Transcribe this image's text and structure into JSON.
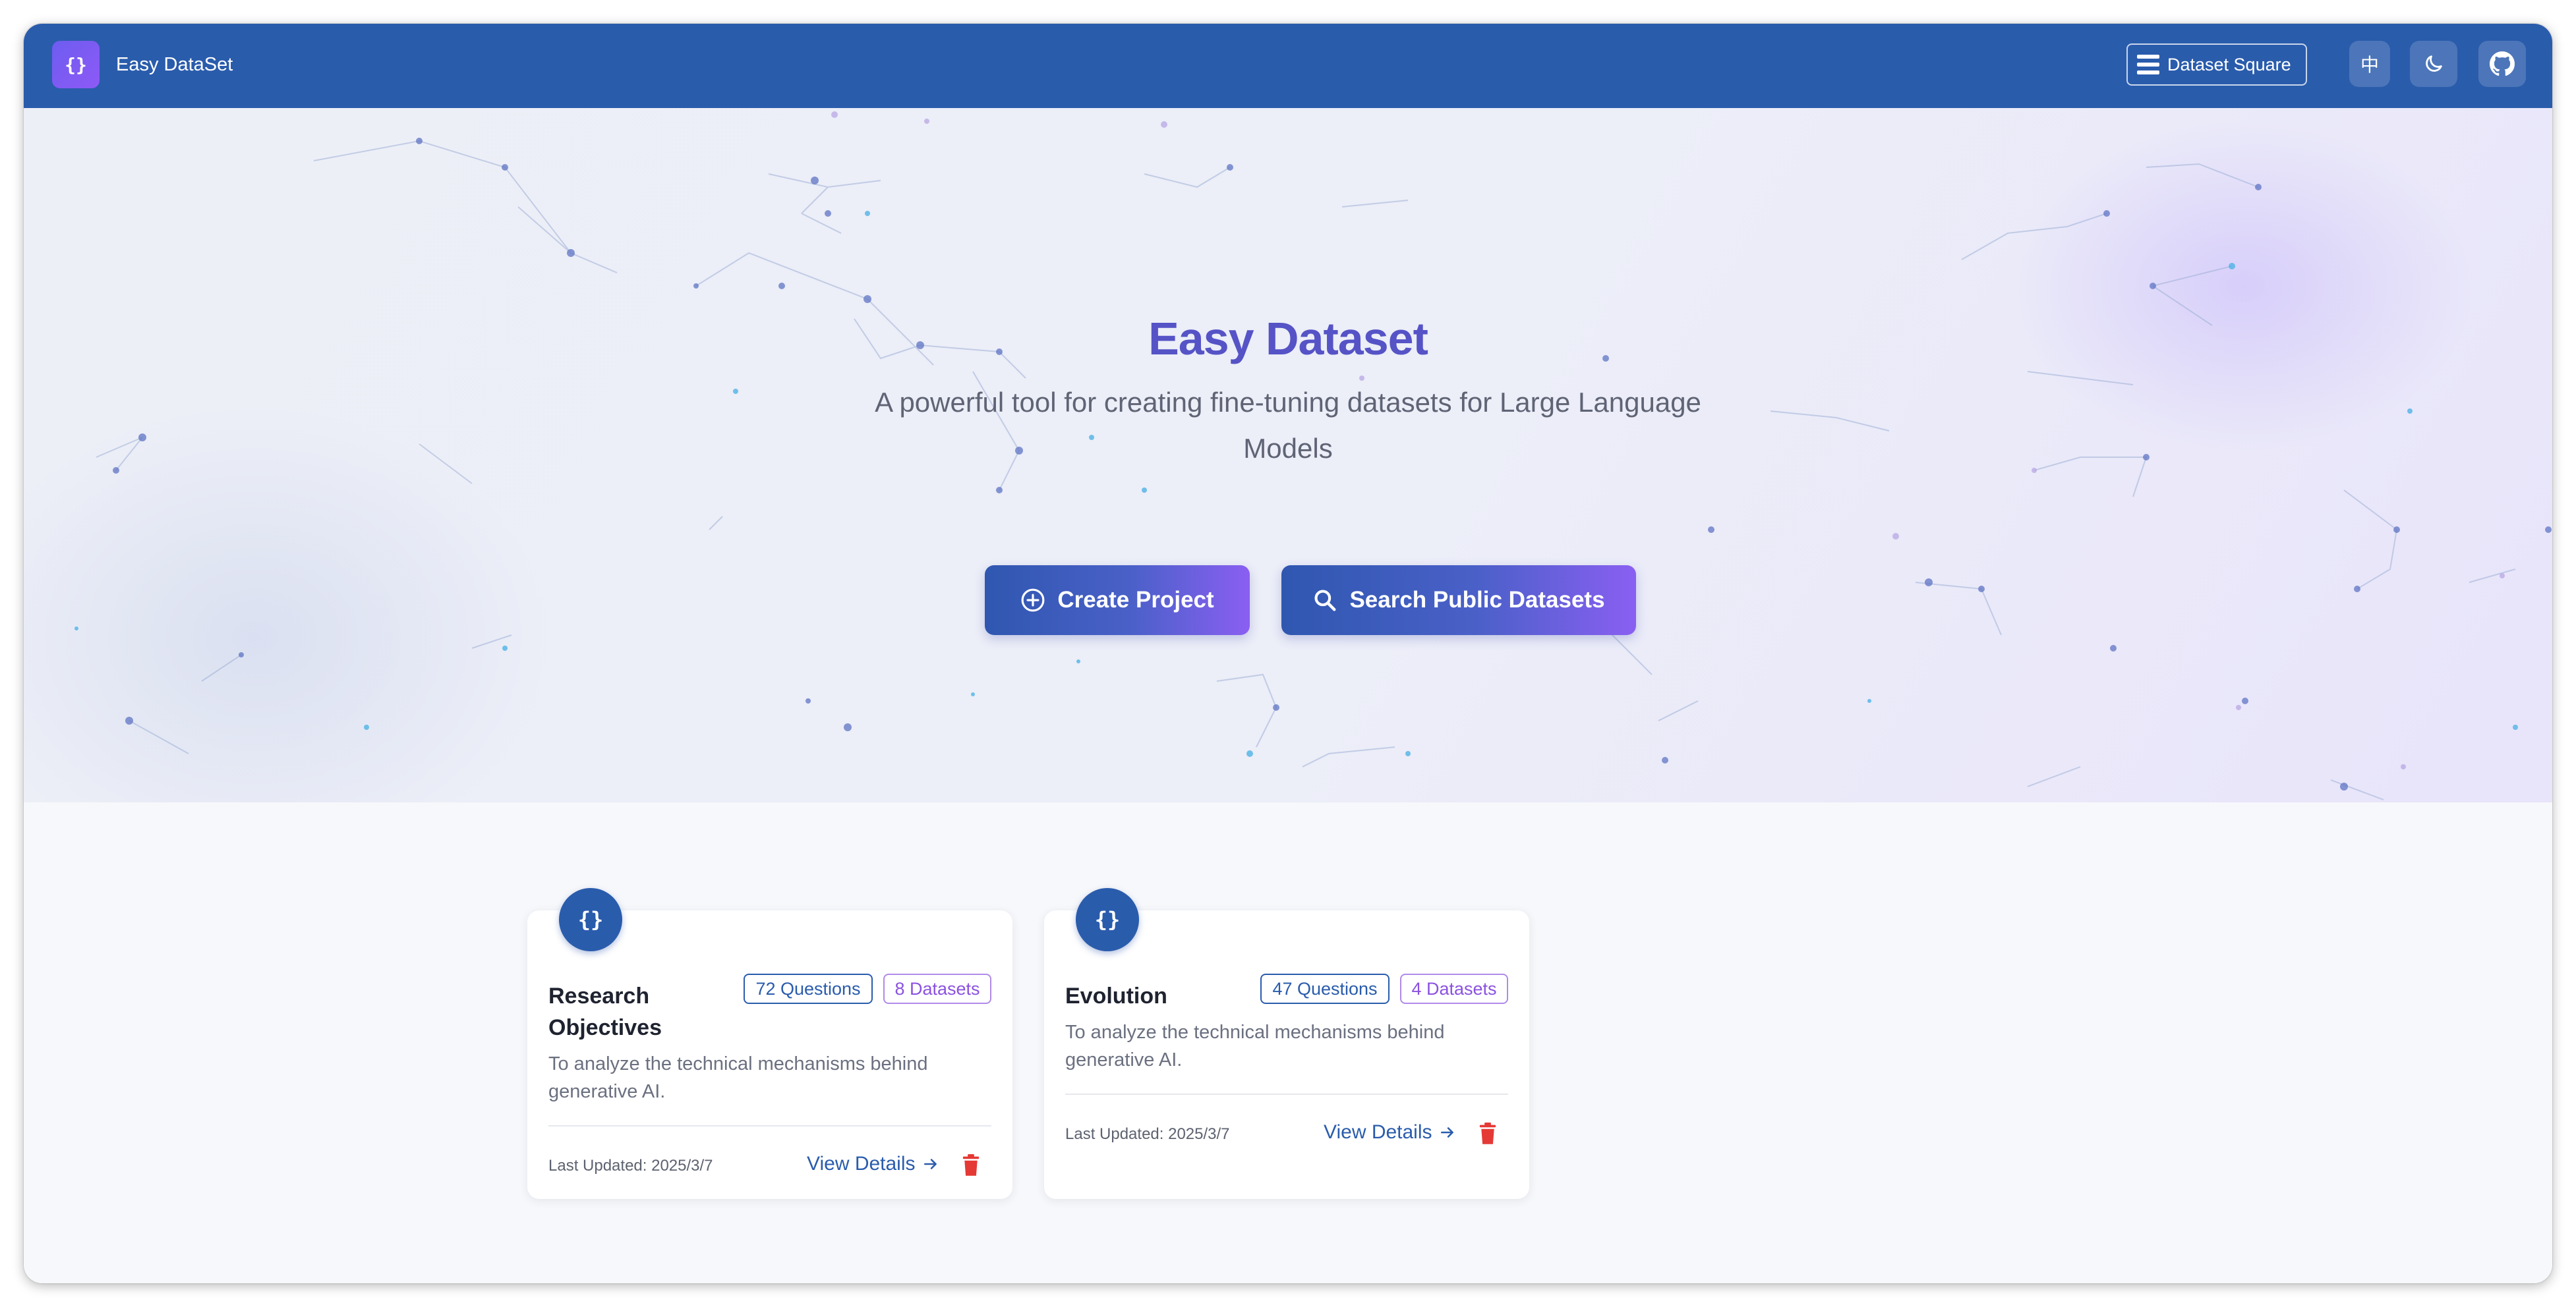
{
  "app": {
    "title": "Easy DataSet",
    "logo_glyph": "{}"
  },
  "header": {
    "dataset_square_label": "Dataset Square",
    "language_label": "中",
    "theme_icon": "moon-icon",
    "github_icon": "github-icon",
    "colors": {
      "bar": "#2a5cac"
    }
  },
  "hero": {
    "title": "Easy Dataset",
    "subtitle": "A powerful tool for creating fine-tuning datasets for Large Language Models",
    "create_label": "Create Project",
    "search_label": "Search Public Datasets",
    "colors": {
      "title": "#5553c6",
      "gradient_start": "#2f57b0",
      "gradient_end": "#8a5ff2"
    }
  },
  "projects": [
    {
      "icon_glyph": "{}",
      "title": "Research Objectives",
      "questions": "72 Questions",
      "datasets": "8 Datasets",
      "description": "To analyze the technical mechanisms behind generative AI.",
      "updated": "Last Updated: 2025/3/7",
      "view_label": "View Details"
    },
    {
      "icon_glyph": "{}",
      "title": "Evolution",
      "questions": "47 Questions",
      "datasets": "4 Datasets",
      "description": "To analyze the technical mechanisms behind generative AI.",
      "updated": "Last Updated: 2025/3/7",
      "view_label": "View Details"
    }
  ]
}
